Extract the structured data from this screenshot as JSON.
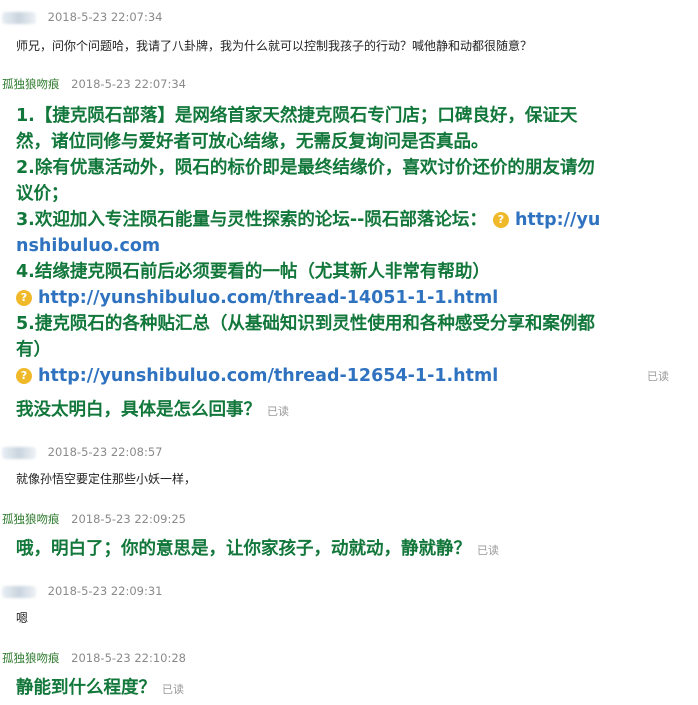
{
  "messages": [
    {
      "sender": "",
      "time": "2018-5-23 22:07:34",
      "text": "师兄，问你个问题哈，我请了八卦牌，我为什么就可以控制我孩子的行动？喊他静和动都很随意？"
    },
    {
      "sender": "孤独狼吻痕",
      "time": "2018-5-23 22:07:34",
      "auto_reply": {
        "l1": "1.【捷克陨石部落】是网络首家天然捷克陨石专门店；口碑良好，保证天",
        "l2": "然，诸位同修与爱好者可放心结缘，无需反复询问是否真品。",
        "l3": "2.除有优惠活动外，陨石的标价即是最终结缘价，喜欢讨价还价的朋友请勿",
        "l4": "议价；",
        "l5_text": "3.欢迎加入专注陨石能量与灵性探索的论坛--陨石部落论坛：",
        "l5_link": "http://yu",
        "l6_link": "nshibuluo.com",
        "l7": "4.结缘捷克陨石前后必须要看的一帖（尤其新人非常有帮助）",
        "l8_link": "http://yunshibuluo.com/thread-14051-1-1.html",
        "l9": "5.捷克陨石的各种贴汇总（从基础知识到灵性使用和各种感受分享和案例都",
        "l10": "有）",
        "l11_link": "http://yunshibuluo.com/thread-12654-1-1.html"
      },
      "status": "已读",
      "reply": "我没太明白，具体是怎么回事？",
      "reply_status": "已读"
    },
    {
      "sender": "",
      "time": "2018-5-23 22:08:57",
      "text": "就像孙悟空要定住那些小妖一样，"
    },
    {
      "sender": "孤独狼吻痕",
      "time": "2018-5-23 22:09:25",
      "text": "哦，明白了；你的意思是，让你家孩子，动就动，静就静？",
      "status": "已读"
    },
    {
      "sender": "",
      "time": "2018-5-23 22:09:31",
      "text": "嗯"
    },
    {
      "sender": "孤独狼吻痕",
      "time": "2018-5-23 22:10:28",
      "text": "静能到什么程度？",
      "status": "已读"
    }
  ],
  "icons": {
    "link_prefix": "question-mark-icon",
    "color": "#f0b92a"
  },
  "colors": {
    "seller_text": "#12773a",
    "link": "#2f73c0",
    "seller_name": "#2e7a2e",
    "timestamp": "#8a8a8a"
  }
}
